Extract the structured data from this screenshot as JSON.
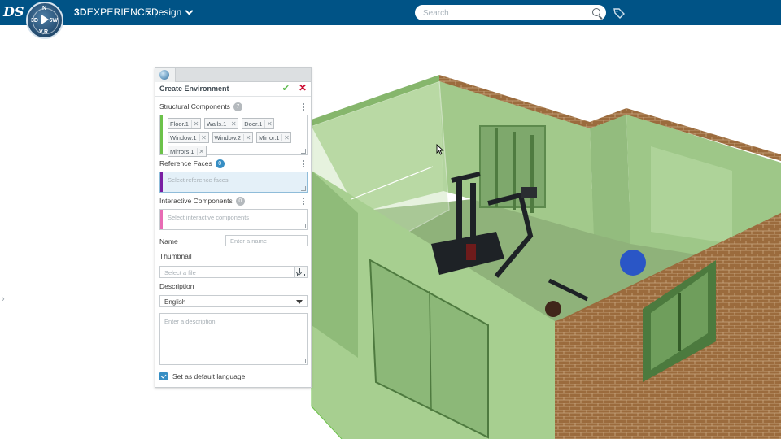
{
  "topbar": {
    "brand_bold": "3D",
    "brand_rest": "EXPERIENCE",
    "separator": "|",
    "app_name": "xDesign",
    "compass": {
      "top": "N",
      "left": "3D",
      "right": "6W",
      "bottom": "V,R"
    },
    "search_placeholder": "Search"
  },
  "panel": {
    "title": "Create Environment",
    "structural": {
      "label": "Structural Components",
      "count": "7",
      "chips": [
        "Floor.1",
        "Walls.1",
        "Door.1",
        "Window.1",
        "Window.2",
        "Mirror.1",
        "Mirrors.1"
      ]
    },
    "reference": {
      "label": "Reference Faces",
      "count": "0",
      "placeholder": "Select reference faces"
    },
    "interactive": {
      "label": "Interactive Components",
      "count": "0",
      "placeholder": "Select interactive components"
    },
    "name": {
      "label": "Name",
      "placeholder": "Enter a name"
    },
    "thumbnail": {
      "label": "Thumbnail",
      "placeholder": "Select a file"
    },
    "description": {
      "label": "Description",
      "language": "English",
      "placeholder": "Enter a description",
      "default_label": "Set as default language"
    }
  },
  "colors": {
    "header": "#005386",
    "accent_structural": "#6cc24a",
    "accent_reference": "#7a1fa2",
    "accent_interactive": "#e86bb4",
    "wall_green": "#9fc98a",
    "brick": "#9a6a3c",
    "ok_green": "#57b847",
    "cancel_red": "#cc092f"
  }
}
